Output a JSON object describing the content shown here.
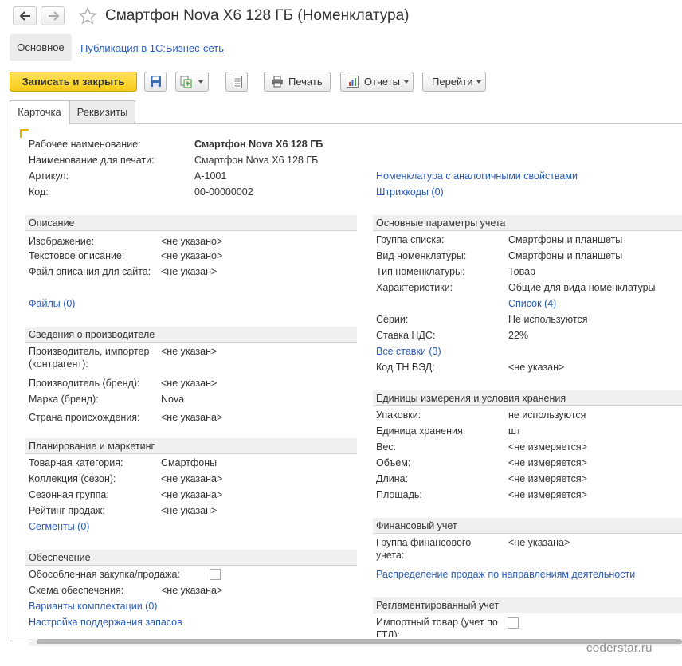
{
  "window": {
    "title": "Смартфон Nova X6 128 ГБ (Номенклатура)"
  },
  "sections": {
    "main": "Основное",
    "publication": "Публикация в 1С:Бизнес-сеть"
  },
  "toolbar": {
    "save_close": "Записать и закрыть",
    "print": "Печать",
    "reports": "Отчеты",
    "goto": "Перейти"
  },
  "tabs": [
    "Карточка",
    "Реквизиты"
  ],
  "header": {
    "working_name_label": "Рабочее наименование:",
    "working_name": "Смартфон Nova X6 128 ГБ",
    "print_name_label": "Наименование для печати:",
    "print_name": "Смартфон Nova X6 128 ГБ",
    "article_label": "Артикул:",
    "article": "A-1001",
    "code_label": "Код:",
    "code": "00-00000002",
    "similar_link": "Номенклатура с аналогичными свойствами",
    "barcodes_link": "Штрихкоды (0)"
  },
  "description": {
    "title": "Описание",
    "image_label": "Изображение:",
    "image": "<не указано>",
    "text_label": "Текстовое описание:",
    "text": "<не указано>",
    "file_label": "Файл описания для сайта:",
    "file": "<не указан>",
    "files_link": "Файлы (0)"
  },
  "manufacturer": {
    "title": "Сведения о производителе",
    "producer_label_1": "Производитель, импортер",
    "producer_label_2": "(контрагент):",
    "producer": "<не указан>",
    "producer_brand_label": "Производитель (бренд):",
    "producer_brand": "<не указан>",
    "mark_label": "Марка (бренд):",
    "mark": "Nova",
    "country_label": "Страна происхождения:",
    "country": "<не указана>"
  },
  "planning": {
    "title": "Планирование и маркетинг",
    "category_label": "Товарная категория:",
    "category": "Смартфоны",
    "collection_label": "Коллекция (сезон):",
    "collection": "<не указана>",
    "season_label": "Сезонная группа:",
    "season": "<не указана>",
    "rating_label": "Рейтинг продаж:",
    "rating": "<не указан>",
    "segments_link": "Сегменты (0)"
  },
  "supply": {
    "title": "Обеспечение",
    "separate_label": "Обособленная закупка/продажа:",
    "scheme_label": "Схема обеспечения:",
    "scheme": "<не указана>",
    "kits_link": "Варианты комплектации (0)",
    "stock_link": "Настройка поддержания запасов"
  },
  "accounting": {
    "title": "Основные параметры учета",
    "list_group_label": "Группа списка:",
    "list_group": "Смартфоны и планшеты",
    "kind_label": "Вид номенклатуры:",
    "kind": "Смартфоны и планшеты",
    "type_label": "Тип номенклатуры:",
    "type": "Товар",
    "chars_label": "Характеристики:",
    "chars": "Общие для вида номенклатуры",
    "list_link": "Список (4)",
    "series_label": "Серии:",
    "series": "Не используются",
    "vat_label": "Ставка НДС:",
    "vat": "22%",
    "all_rates_link": "Все ставки (3)",
    "tnved_label": "Код ТН ВЭД:",
    "tnved": "<не указан>"
  },
  "units": {
    "title": "Единицы измерения и условия хранения",
    "packs_label": "Упаковки:",
    "packs": "не используются",
    "unit_label": "Единица хранения:",
    "unit": "шт",
    "weight_label": "Вес:",
    "weight": "<не измеряется>",
    "volume_label": "Объем:",
    "volume": "<не измеряется>",
    "length_label": "Длина:",
    "length": "<не измеряется>",
    "area_label": "Площадь:",
    "area": "<не измеряется>"
  },
  "finance": {
    "title": "Финансовый учет",
    "group_label_1": "Группа финансового",
    "group_label_2": "учета:",
    "group": "<не указана>",
    "distribution_link": "Распределение продаж по направлениям деятельности"
  },
  "regulated": {
    "title": "Регламентированный учет",
    "import_label_1": "Импортный товар (учет по",
    "import_label_2": "ГТД):"
  },
  "watermark": "coderstar.ru",
  "colors": {
    "accent_yellow": "#f5cb18",
    "link_blue": "#2a5bb8",
    "group_bg": "#f0f0f0"
  }
}
